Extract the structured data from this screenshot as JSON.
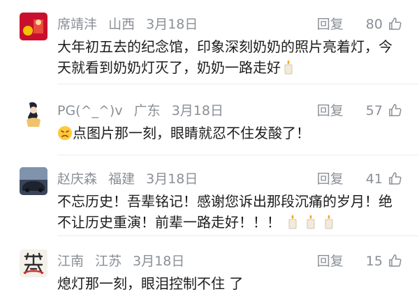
{
  "comments": [
    {
      "username": "席靖沣",
      "location": "山西",
      "date": "3月18日",
      "reply_label": "回复",
      "likes": "80",
      "text_lines": [
        "大年初五去的纪念馆，印象深刻奶奶的照片亮着灯，今",
        "天就看到奶奶灯灭了，奶奶一路走好"
      ],
      "trailing_icons": [
        "candle-icon"
      ]
    },
    {
      "username": "PG(^_^)v",
      "location": "广东",
      "date": "3月18日",
      "reply_label": "回复",
      "likes": "57",
      "leading_icon": "sad-face-emoji",
      "text_lines": [
        "点图片那一刻，眼睛就忍不住发酸了！"
      ]
    },
    {
      "username": "赵庆森",
      "location": "福建",
      "date": "3月18日",
      "reply_label": "回复",
      "likes": "41",
      "text_lines": [
        "不忘历史！吾辈铭记！感谢您诉出那段沉痛的岁月！绝",
        "不让历史重演！前辈一路走好！！！"
      ],
      "trailing_icons": [
        "candle-icon",
        "candle-icon",
        "candle-icon"
      ]
    },
    {
      "username": "江南",
      "location": "江苏",
      "date": "3月18日",
      "reply_label": "回复",
      "likes": "15",
      "text_lines": [
        "熄灯那一刻，眼泪控制不住 了"
      ]
    }
  ],
  "colors": {
    "meta_text": "#8a8f96",
    "body_text": "#1c1c1c",
    "divider": "#ededed"
  }
}
